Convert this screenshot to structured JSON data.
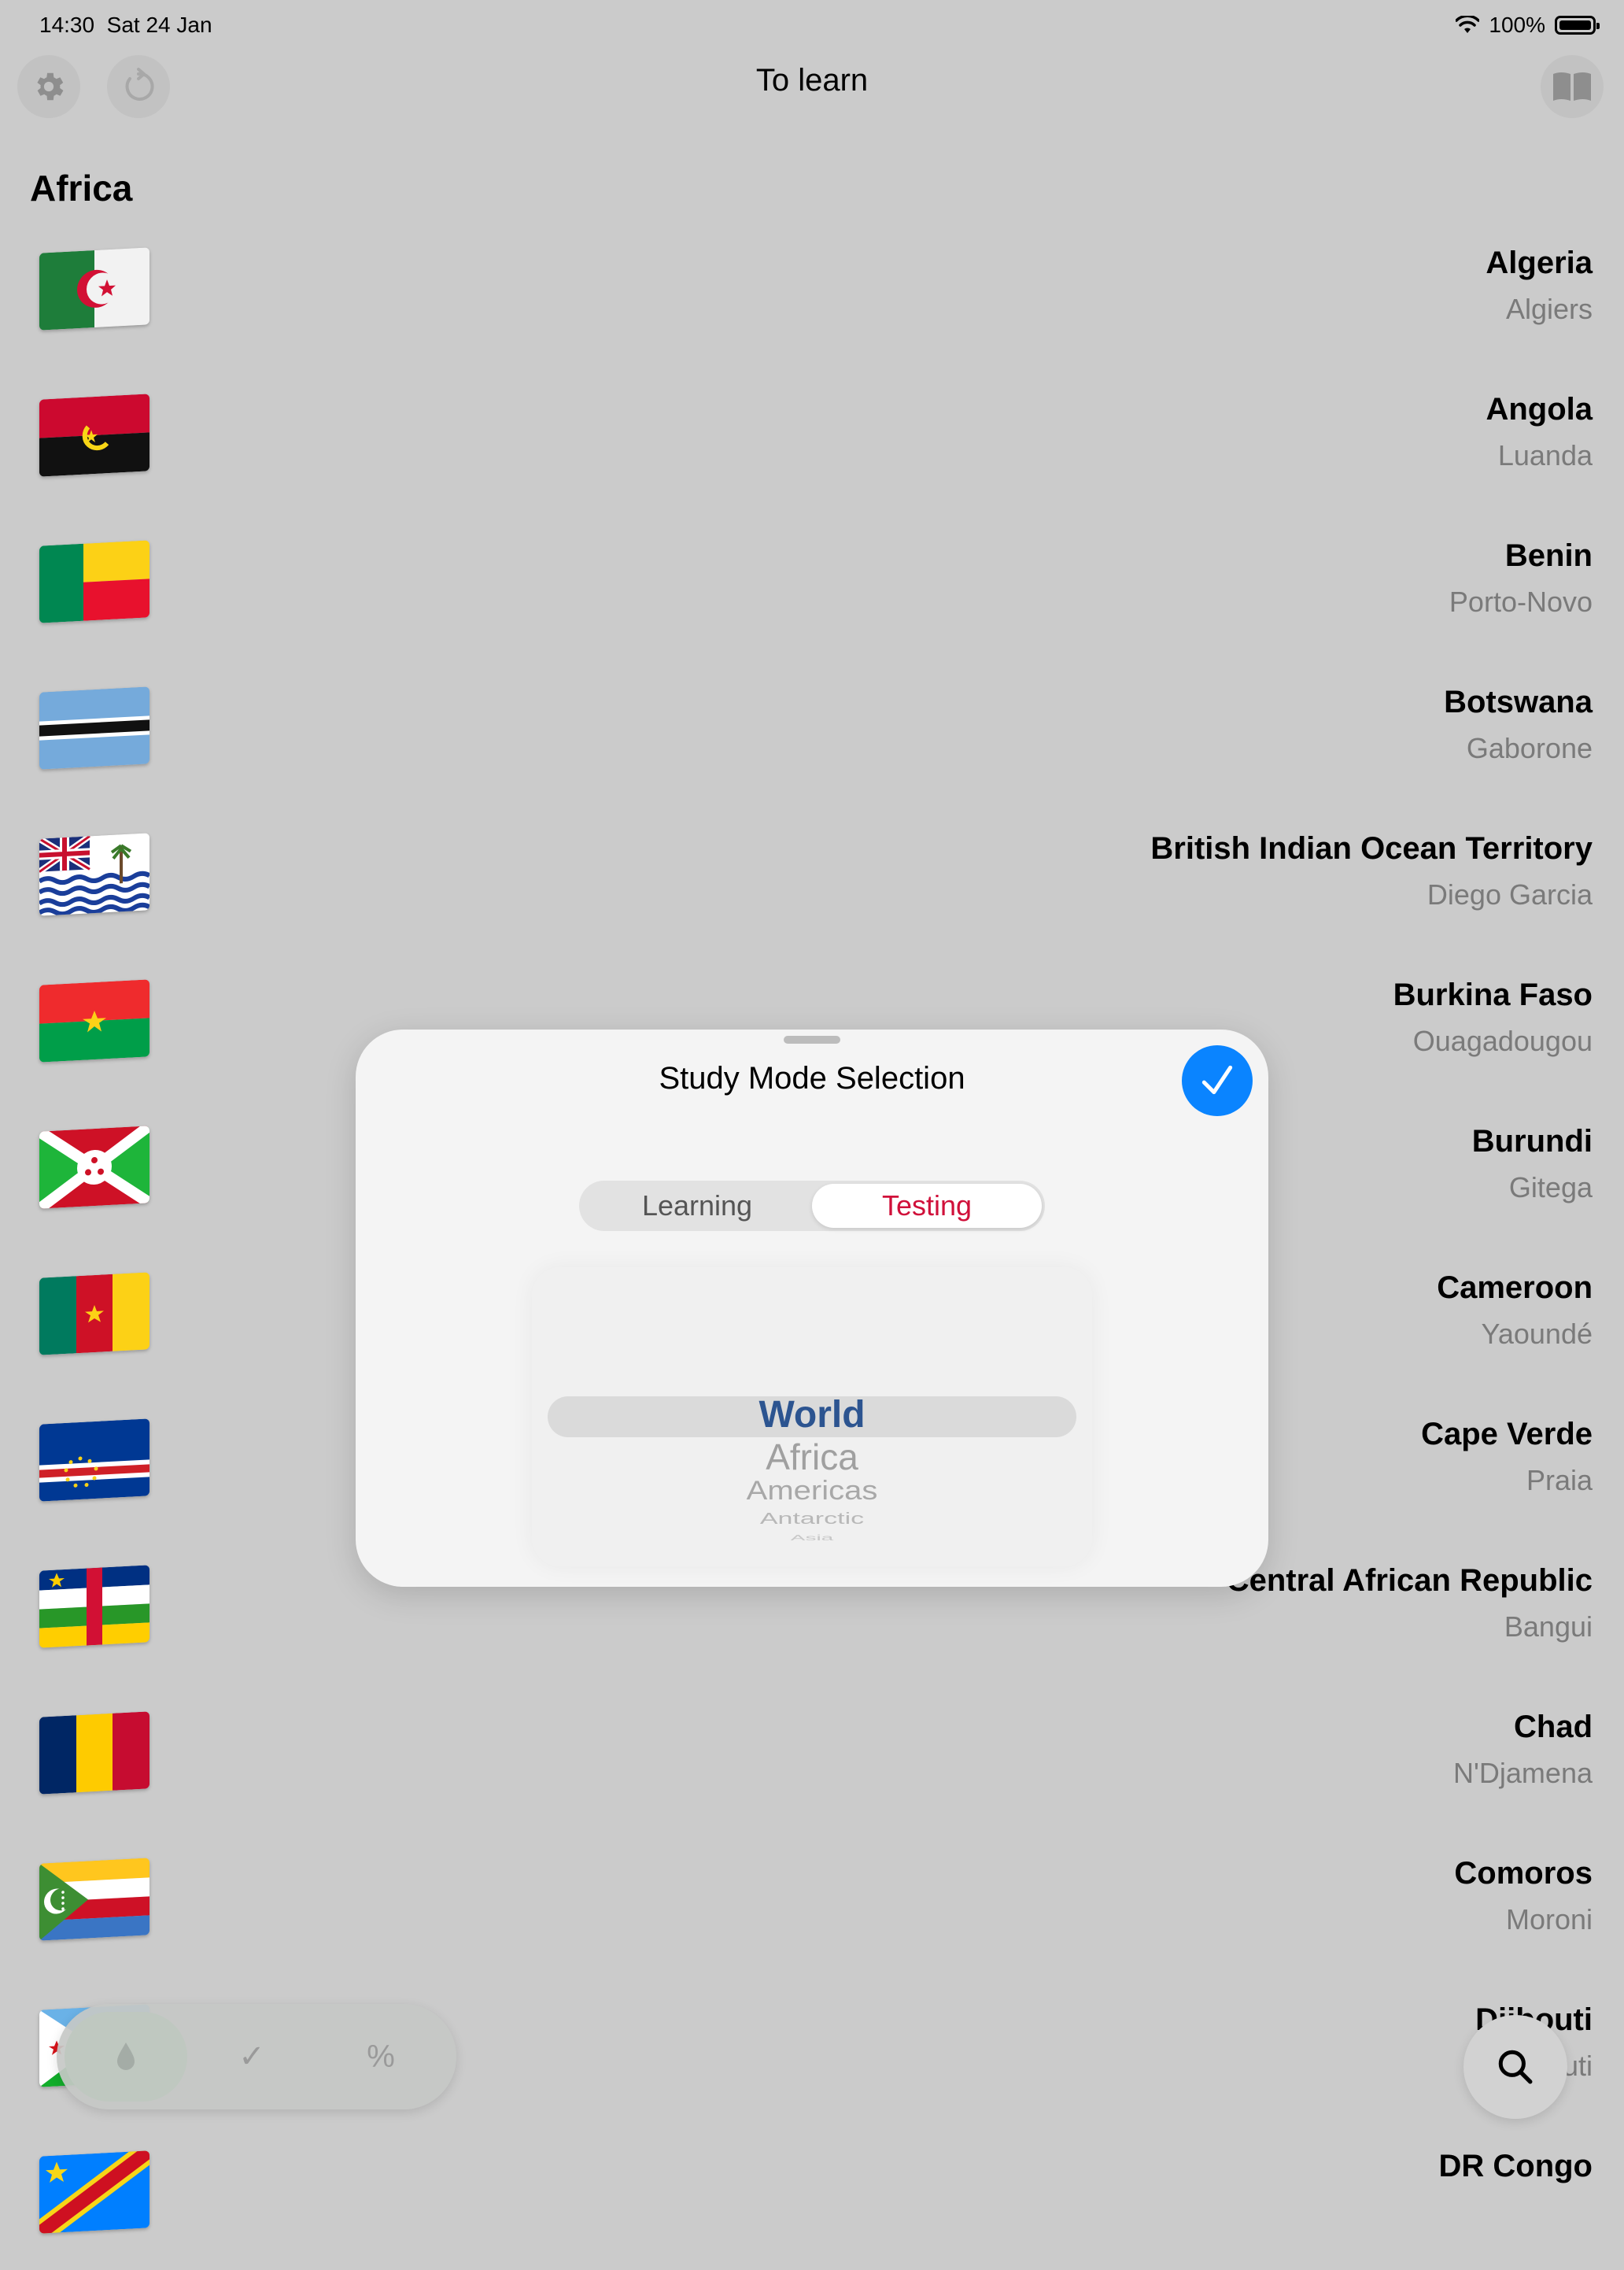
{
  "status_bar": {
    "time": "14:30",
    "date": "Sat 24 Jan",
    "battery": "100%"
  },
  "nav": {
    "title": "To learn"
  },
  "section": {
    "title": "Africa"
  },
  "countries": [
    {
      "name": "Algeria",
      "capital": "Algiers"
    },
    {
      "name": "Angola",
      "capital": "Luanda"
    },
    {
      "name": "Benin",
      "capital": "Porto-Novo"
    },
    {
      "name": "Botswana",
      "capital": "Gaborone"
    },
    {
      "name": "British Indian Ocean Territory",
      "capital": "Diego Garcia"
    },
    {
      "name": "Burkina Faso",
      "capital": "Ouagadougou"
    },
    {
      "name": "Burundi",
      "capital": "Gitega"
    },
    {
      "name": "Cameroon",
      "capital": "Yaoundé"
    },
    {
      "name": "Cape Verde",
      "capital": "Praia"
    },
    {
      "name": "Central African Republic",
      "capital": "Bangui"
    },
    {
      "name": "Chad",
      "capital": "N'Djamena"
    },
    {
      "name": "Comoros",
      "capital": "Moroni"
    },
    {
      "name": "Djibouti",
      "capital": "Djibouti"
    },
    {
      "name": "DR Congo",
      "capital": ""
    }
  ],
  "modal": {
    "title": "Study Mode Selection",
    "segments": [
      "Learning",
      "Testing"
    ],
    "selected_segment": "Testing",
    "picker_options": [
      "World",
      "Africa",
      "Americas",
      "Antarctic",
      "Asia"
    ],
    "picker_selected": "World"
  },
  "tabbar": {
    "tab2_symbol": "✓",
    "tab3_symbol": "%"
  },
  "colors": {
    "accent": "#0a84ff",
    "testing": "#d0103a",
    "picker_selected": "#2c5490"
  }
}
